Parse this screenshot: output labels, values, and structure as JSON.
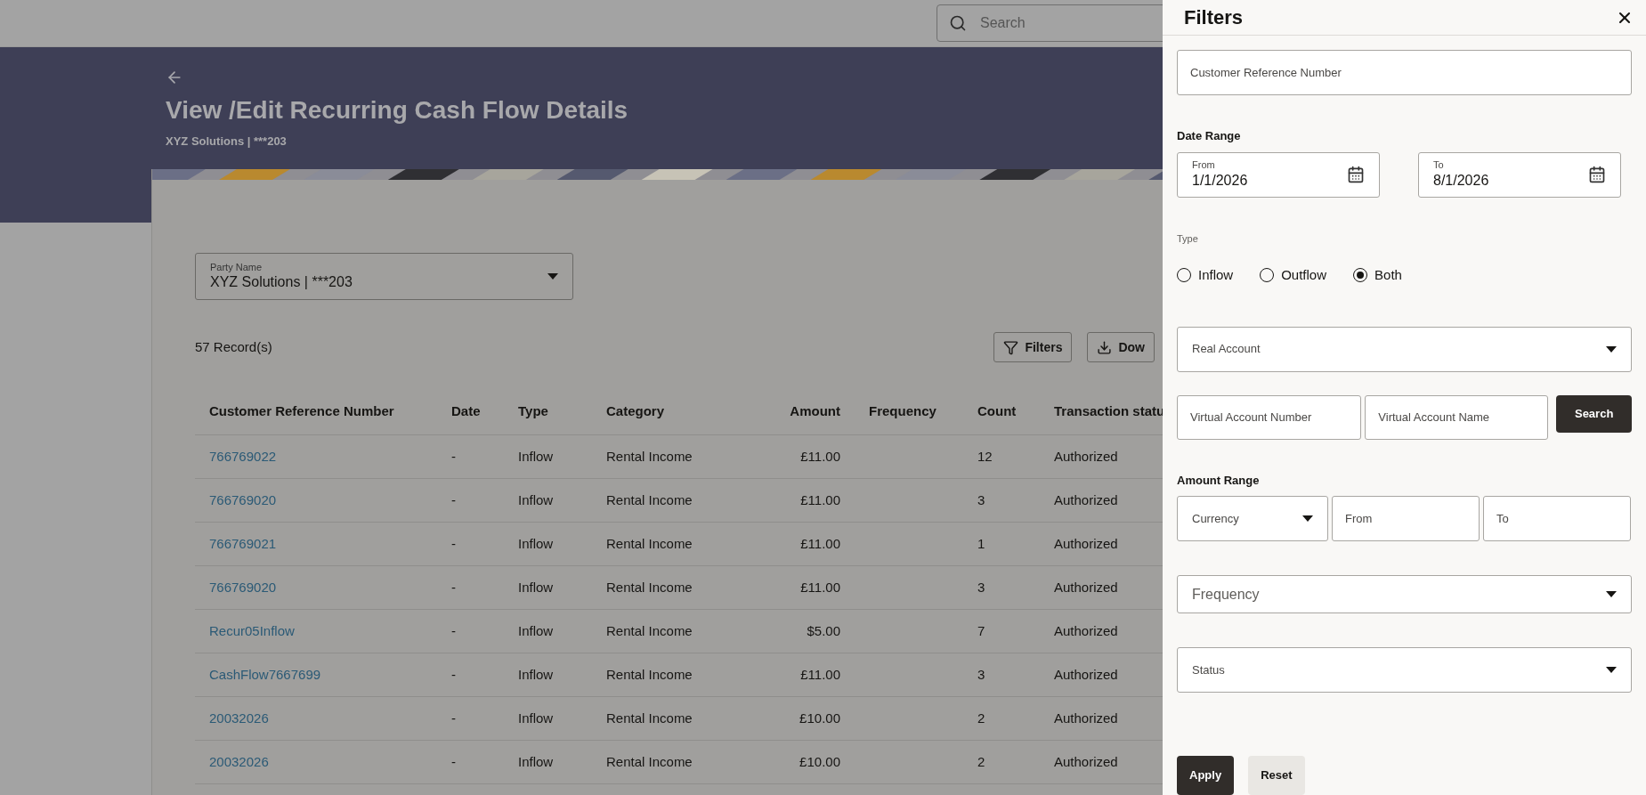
{
  "top_bar": {
    "search": {
      "placeholder": "Search"
    }
  },
  "header": {
    "title": "View /Edit Recurring Cash Flow Details",
    "subtitle": "XYZ Solutions | ***203"
  },
  "party_field": {
    "label": "Party Name",
    "value": "XYZ Solutions | ***203"
  },
  "records": "57 Record(s)",
  "toolbar": [
    {
      "label": "Filters",
      "kind": "filter"
    },
    {
      "label": "Dow",
      "kind": "download"
    }
  ],
  "table": {
    "columns": [
      "Customer Reference Number",
      "Date",
      "Type",
      "Category",
      "Amount",
      "Frequency",
      "Count",
      "Transaction statu"
    ],
    "rows": [
      {
        "reference": "766769022",
        "date": "-",
        "type": "Inflow",
        "category": "Rental Income",
        "amount": "£11.00",
        "count": "12",
        "status": "Authorized"
      },
      {
        "reference": "766769020",
        "date": "-",
        "type": "Inflow",
        "category": "Rental Income",
        "amount": "£11.00",
        "count": "3",
        "status": "Authorized"
      },
      {
        "reference": "766769021",
        "date": "-",
        "type": "Inflow",
        "category": "Rental Income",
        "amount": "£11.00",
        "count": "1",
        "status": "Authorized"
      },
      {
        "reference": "766769020",
        "date": "-",
        "type": "Inflow",
        "category": "Rental Income",
        "amount": "£11.00",
        "count": "3",
        "status": "Authorized"
      },
      {
        "reference": "Recur05Inflow",
        "date": "-",
        "type": "Inflow",
        "category": "Rental Income",
        "amount": "$5.00",
        "count": "7",
        "status": "Authorized"
      },
      {
        "reference": "CashFlow7667699",
        "date": "-",
        "type": "Inflow",
        "category": "Rental Income",
        "amount": "£11.00",
        "count": "3",
        "status": "Authorized"
      },
      {
        "reference": "20032026",
        "date": "-",
        "type": "Inflow",
        "category": "Rental Income",
        "amount": "£10.00",
        "count": "2",
        "status": "Authorized"
      },
      {
        "reference": "20032026",
        "date": "-",
        "type": "Inflow",
        "category": "Rental Income",
        "amount": "£10.00",
        "count": "2",
        "status": "Authorized"
      }
    ]
  },
  "filters_panel": {
    "title": "Filters",
    "customer_reference": {
      "placeholder": "Customer Reference Number"
    },
    "date_range": {
      "label": "Date Range",
      "from": {
        "label": "From",
        "value": "1/1/2026"
      },
      "to": {
        "label": "To",
        "value": "8/1/2026"
      }
    },
    "type": {
      "label": "Type",
      "options": [
        {
          "label": "Inflow",
          "selected": false
        },
        {
          "label": "Outflow",
          "selected": false
        },
        {
          "label": "Both",
          "selected": true
        }
      ]
    },
    "real_account": {
      "placeholder": "Real Account"
    },
    "virtual_account_number": {
      "placeholder": "Virtual Account Number"
    },
    "virtual_account_name": {
      "placeholder": "Virtual Account Name"
    },
    "search_button": "Search",
    "amount_range": {
      "label": "Amount Range",
      "currency": {
        "placeholder": "Currency"
      },
      "from": {
        "placeholder": "From"
      },
      "to": {
        "placeholder": "To"
      }
    },
    "frequency": {
      "placeholder": "Frequency"
    },
    "status": {
      "placeholder": "Status"
    },
    "buttons": [
      {
        "label": "Apply",
        "kind": "primary"
      },
      {
        "label": "Reset",
        "kind": "secondary"
      }
    ]
  }
}
